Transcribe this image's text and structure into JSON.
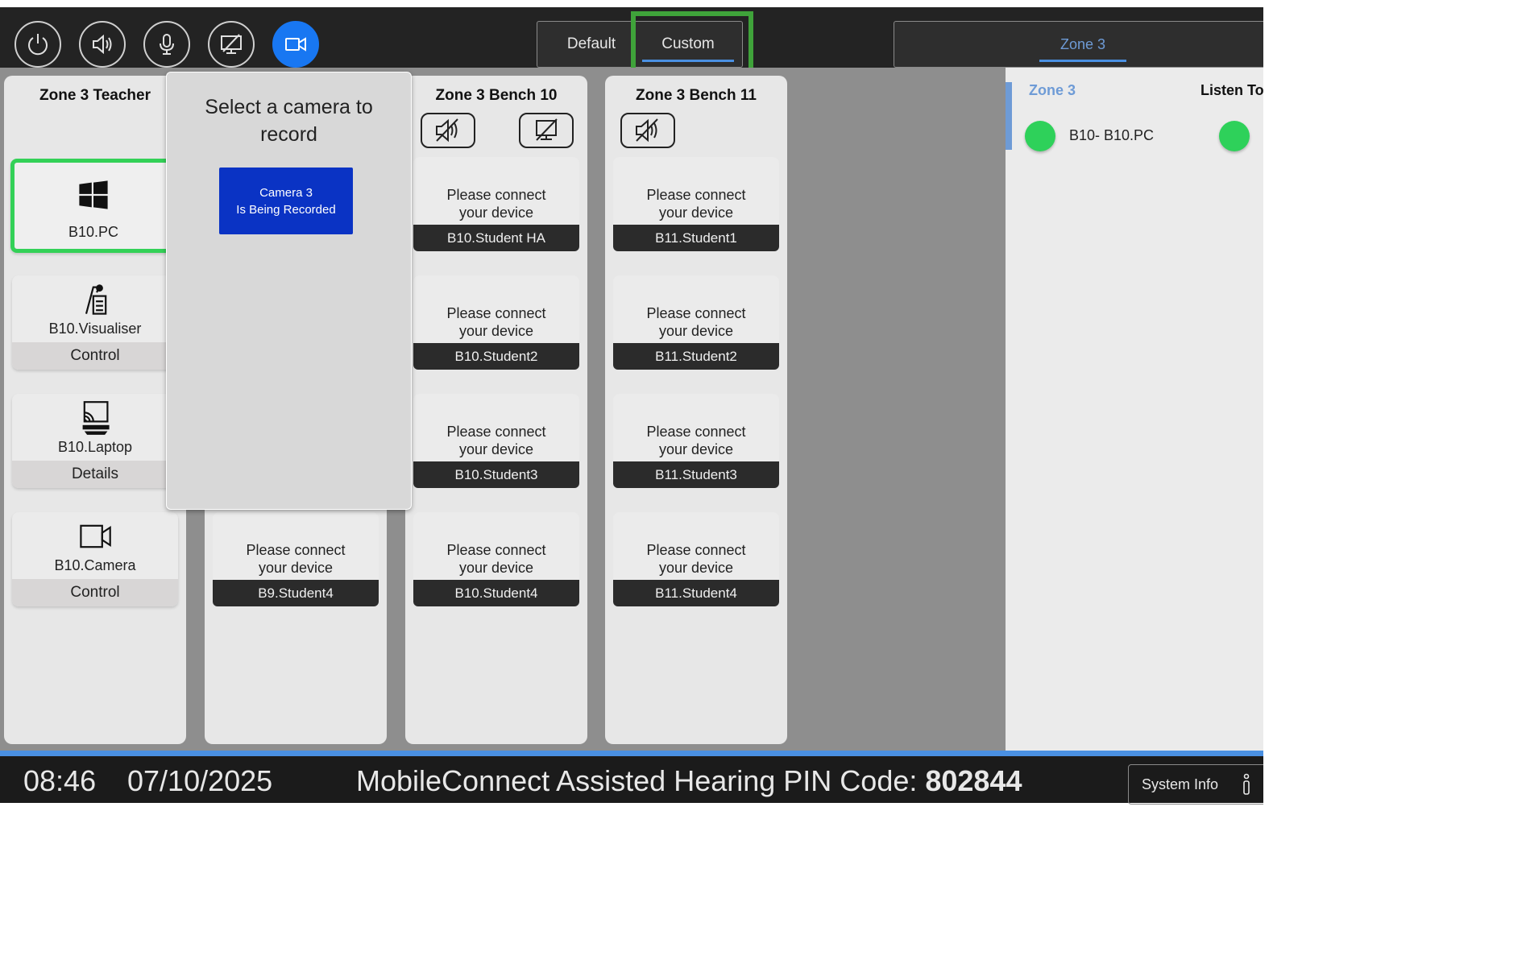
{
  "toolbar": {
    "buttons": [
      {
        "icon": "power-icon",
        "active": false
      },
      {
        "icon": "speaker-icon",
        "active": false
      },
      {
        "icon": "microphone-icon",
        "active": false
      },
      {
        "icon": "screen-off-icon",
        "active": false
      },
      {
        "icon": "camera-icon",
        "active": true
      }
    ],
    "mode_default": "Default",
    "mode_custom": "Custom",
    "zone_tab": "Zone 3"
  },
  "colors": {
    "accent_blue": "#1877f2",
    "highlight_green": "#3fa33a",
    "status_green": "#2ed15a",
    "record_blue": "#0a33c4",
    "zone_blue": "#6e9bd6"
  },
  "teacher": {
    "title": "Zone 3 Teacher",
    "tiles": [
      {
        "name": "B10.PC",
        "icon": "windows-icon",
        "action": ""
      },
      {
        "name": "B10.Visualiser",
        "icon": "visualiser-icon",
        "action": "Control"
      },
      {
        "name": "B10.Laptop",
        "icon": "cast-laptop-icon",
        "action": "Details"
      },
      {
        "name": "B10.Camera",
        "icon": "video-camera-icon",
        "action": "Control"
      }
    ]
  },
  "bench9": {
    "devices": [
      {
        "msg": "Please connect your device",
        "name": "B9.Student4"
      }
    ]
  },
  "bench10": {
    "title": "Zone 3 Bench 10",
    "devices": [
      {
        "msg": "Please connect your device",
        "name": "B10.Student HA"
      },
      {
        "msg": "Please connect your device",
        "name": "B10.Student2"
      },
      {
        "msg": "Please connect your device",
        "name": "B10.Student3"
      },
      {
        "msg": "Please connect your device",
        "name": "B10.Student4"
      }
    ]
  },
  "bench11": {
    "title": "Zone 3 Bench 11",
    "devices": [
      {
        "msg": "Please connect your device",
        "name": "B11.Student1"
      },
      {
        "msg": "Please connect your device",
        "name": "B11.Student2"
      },
      {
        "msg": "Please connect your device",
        "name": "B11.Student3"
      },
      {
        "msg": "Please connect your device",
        "name": "B11.Student4"
      }
    ]
  },
  "popup": {
    "title": "Select a camera to record",
    "button_line1": "Camera 3",
    "button_line2": "Is Being Recorded"
  },
  "right_panel": {
    "zone": "Zone 3",
    "listen": "Listen To",
    "device": "B10-  B10.PC"
  },
  "footer": {
    "time": "08:46",
    "date": "07/10/2025",
    "pin_label": "MobileConnect Assisted Hearing PIN Code: ",
    "pin_code": "802844",
    "system_info": "System Info"
  }
}
